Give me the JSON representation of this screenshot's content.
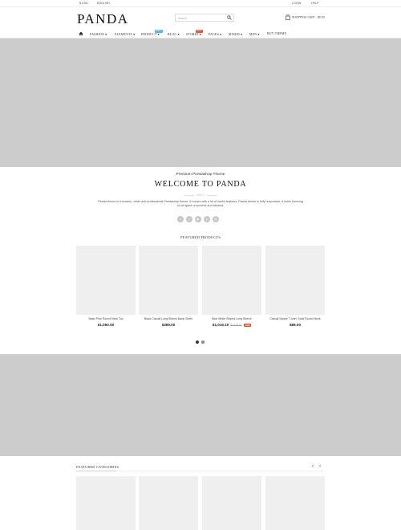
{
  "topbar": {
    "currency": "$ USD",
    "language": "ENGLISH",
    "login": "LOGIN",
    "help": "HELP"
  },
  "header": {
    "logo": "PANDA",
    "search_placeholder": "Search",
    "cart_label": "SHOPPING CART - $0.00"
  },
  "nav": {
    "items": [
      {
        "label": "FASHION"
      },
      {
        "label": "ELEMENTS"
      },
      {
        "label": "PRODUCT",
        "badge": "NEW",
        "badge_color": "#4fb7e3"
      },
      {
        "label": "BLOG"
      },
      {
        "label": "STORES",
        "badge": "HOT",
        "badge_color": "#e2533b"
      },
      {
        "label": "PAGES"
      },
      {
        "label": "MIXED"
      },
      {
        "label": "MEN"
      },
      {
        "label": "BUY THEME"
      }
    ]
  },
  "welcome": {
    "subtitle": "Premium Prestashop Theme",
    "title": "WELCOME TO PANDA",
    "divider_text": "PANDA",
    "description": "Panda theme is a modern, clean and professional Prestashop theme. It comes with a lot of useful features. Panda theme is fully responsive, it looks stunning on all types of screens and devices."
  },
  "social_icons": [
    "twitter-icon",
    "facebook-icon",
    "youtube-icon",
    "pinterest-icon",
    "instagram-icon"
  ],
  "featured_products": {
    "title": "FEATURED PRODUCTS",
    "products": [
      {
        "name": "Basic Pink Round Neck Top",
        "price": "$1,060.00"
      },
      {
        "name": "Black Casual Long Sleeve Basic Shirts",
        "price": "$389.00"
      },
      {
        "name": "Blue White Striped Long Sleeve",
        "price": "$1,016.10",
        "old_price": "$1,129.00",
        "discount": "-10%"
      },
      {
        "name": "Casual Simple T-shirt, Solid Round Neck",
        "price": "$86.00"
      }
    ]
  },
  "featured_categories": {
    "title": "FEATURED CATEGORIES"
  },
  "colors": {
    "banner": "#cccccc",
    "placeholder": "#efefef",
    "discount": "#e2533b",
    "new_badge": "#4fb7e3"
  }
}
